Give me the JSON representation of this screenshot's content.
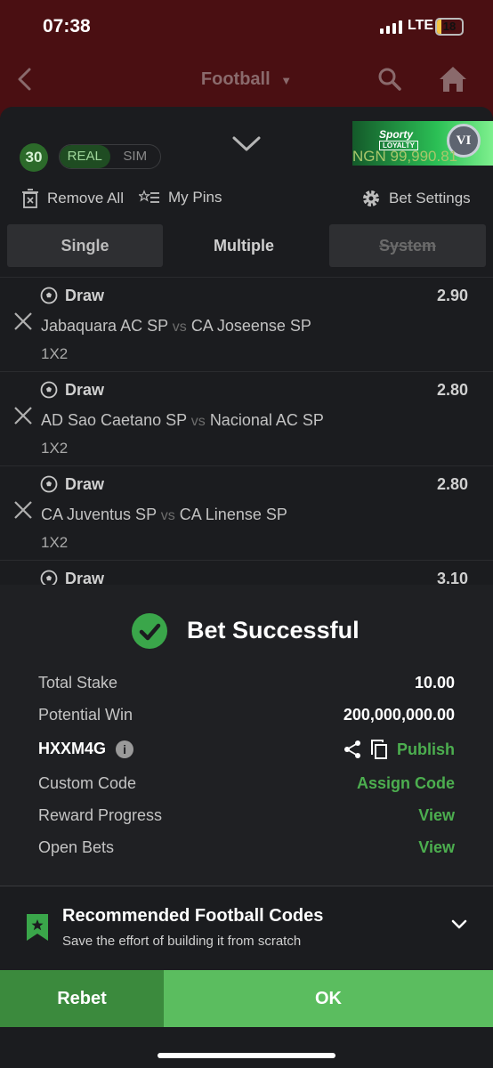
{
  "status": {
    "time": "07:38",
    "network": "LTE",
    "battery": "18"
  },
  "nav": {
    "title": "Football",
    "back_icon": "chevron-left-icon",
    "search_icon": "search-icon",
    "home_icon": "home-icon"
  },
  "betslip": {
    "count": "30",
    "mode_real": "REAL",
    "mode_sim": "SIM",
    "loyalty_brand": "Sporty",
    "loyalty_sub": "LOYALTY",
    "loyalty_tier": "VI",
    "balance": "NGN 99,990.81",
    "remove_all": "Remove All",
    "my_pins": "My Pins",
    "bet_settings": "Bet Settings",
    "tabs": {
      "single": "Single",
      "multiple": "Multiple",
      "system": "System"
    },
    "selections": [
      {
        "pick": "Draw",
        "odds": "2.90",
        "home": "Jabaquara AC SP",
        "vs": "vs",
        "away": "CA Joseense SP",
        "market": "1X2"
      },
      {
        "pick": "Draw",
        "odds": "2.80",
        "home": "AD Sao Caetano SP",
        "vs": "vs",
        "away": "Nacional AC SP",
        "market": "1X2"
      },
      {
        "pick": "Draw",
        "odds": "2.80",
        "home": "CA Juventus SP",
        "vs": "vs",
        "away": "CA Linense SP",
        "market": "1X2"
      },
      {
        "pick": "Draw",
        "odds": "3.10"
      }
    ]
  },
  "success": {
    "title": "Bet Successful",
    "total_stake_label": "Total Stake",
    "total_stake": "10.00",
    "potential_win_label": "Potential Win",
    "potential_win": "200,000,000.00",
    "booking_code": "HXXM4G",
    "info_glyph": "i",
    "publish": "Publish",
    "custom_code_label": "Custom Code",
    "assign_code": "Assign Code",
    "reward_progress_label": "Reward Progress",
    "reward_view": "View",
    "open_bets_label": "Open Bets",
    "open_bets_view": "View",
    "rec_title": "Recommended Football Codes",
    "rec_sub": "Save the effort of building it from scratch",
    "rebet": "Rebet",
    "ok": "OK"
  },
  "colors": {
    "brand_green": "#5bbd5f",
    "link_green": "#4cae4f",
    "header_red": "#4a0f12"
  }
}
